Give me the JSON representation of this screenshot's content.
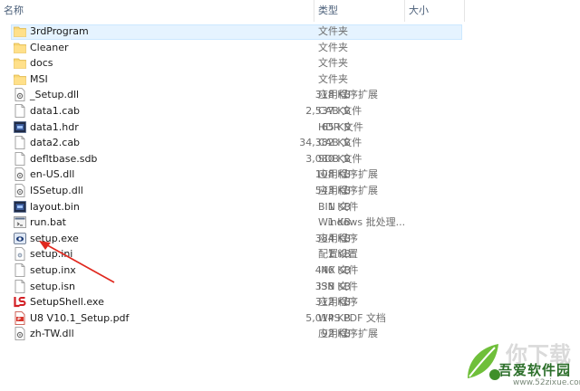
{
  "header": {
    "col_name": "名称",
    "col_type": "类型",
    "col_size": "大小"
  },
  "files": [
    {
      "name": "3rdProgram",
      "type": "文件夹",
      "size": "",
      "icon": "folder-icon",
      "selected": true
    },
    {
      "name": "Cleaner",
      "type": "文件夹",
      "size": "",
      "icon": "folder-icon"
    },
    {
      "name": "docs",
      "type": "文件夹",
      "size": "",
      "icon": "folder-icon"
    },
    {
      "name": "MSI",
      "type": "文件夹",
      "size": "",
      "icon": "folder-icon"
    },
    {
      "name": "_Setup.dll",
      "type": "应用程序扩展",
      "size": "318 KB",
      "icon": "dll-file-icon"
    },
    {
      "name": "data1.cab",
      "type": "CAB 文件",
      "size": "2,537 KB",
      "icon": "cab-file-icon"
    },
    {
      "name": "data1.hdr",
      "type": "HDR 文件",
      "size": "65 KB",
      "icon": "hdr-file-icon"
    },
    {
      "name": "data2.cab",
      "type": "CAB 文件",
      "size": "34,382 KB",
      "icon": "cab-file-icon"
    },
    {
      "name": "defltbase.sdb",
      "type": "SDB 文件",
      "size": "3,080 KB",
      "icon": "blank-file-icon"
    },
    {
      "name": "en-US.dll",
      "type": "应用程序扩展",
      "size": "108 KB",
      "icon": "dll-file-icon"
    },
    {
      "name": "ISSetup.dll",
      "type": "应用程序扩展",
      "size": "543 KB",
      "icon": "dll-file-icon"
    },
    {
      "name": "layout.bin",
      "type": "BIN 文件",
      "size": "1 KB",
      "icon": "bin-file-icon"
    },
    {
      "name": "run.bat",
      "type": "Windows 批处理...",
      "size": "1 KB",
      "icon": "bat-file-icon"
    },
    {
      "name": "setup.exe",
      "type": "应用程序",
      "size": "384 KB",
      "icon": "setup-exe-icon"
    },
    {
      "name": "setup.ini",
      "type": "配置设置",
      "size": "1 KB",
      "icon": "ini-file-icon"
    },
    {
      "name": "setup.inx",
      "type": "INX 文件",
      "size": "446 KB",
      "icon": "blank-file-icon"
    },
    {
      "name": "setup.isn",
      "type": "ISN 文件",
      "size": "338 KB",
      "icon": "blank-file-icon"
    },
    {
      "name": "SetupShell.exe",
      "type": "应用程序",
      "size": "312 KB",
      "icon": "setupshell-exe-icon"
    },
    {
      "name": "U8 V10.1_Setup.pdf",
      "type": "WPS PDF 文档",
      "size": "5,014 KB",
      "icon": "pdf-file-icon"
    },
    {
      "name": "zh-TW.dll",
      "type": "应用程序扩展",
      "size": "92 KB",
      "icon": "dll-file-icon"
    }
  ],
  "annotation": {
    "target": "setup.exe",
    "arrow_color": "#e0281e"
  },
  "watermark": {
    "brand": "吾爱软件园",
    "url": "www.52zixue.com",
    "overlay": "你下载"
  },
  "colors": {
    "selection": "#e5f3ff",
    "header_text": "#4c607a",
    "type_text": "#6d6d6d"
  }
}
